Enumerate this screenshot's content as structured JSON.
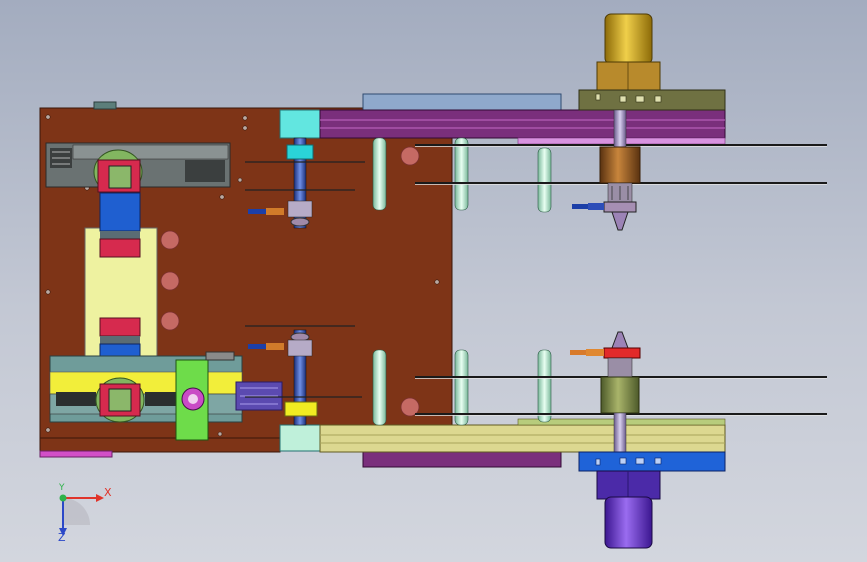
{
  "triad": {
    "x_label": "X",
    "y_label": "Y",
    "z_label": "Z",
    "x_color": "#e0342a",
    "y_color": "#2fb24a",
    "z_color": "#2b48c8"
  },
  "colors": {
    "base_plate": "#7e3417",
    "lower_rail": "#dcd890",
    "upper_rail": "#7a2f7c",
    "motor_top": "#d4a81d",
    "motor_bottom": "#6a34c8"
  }
}
